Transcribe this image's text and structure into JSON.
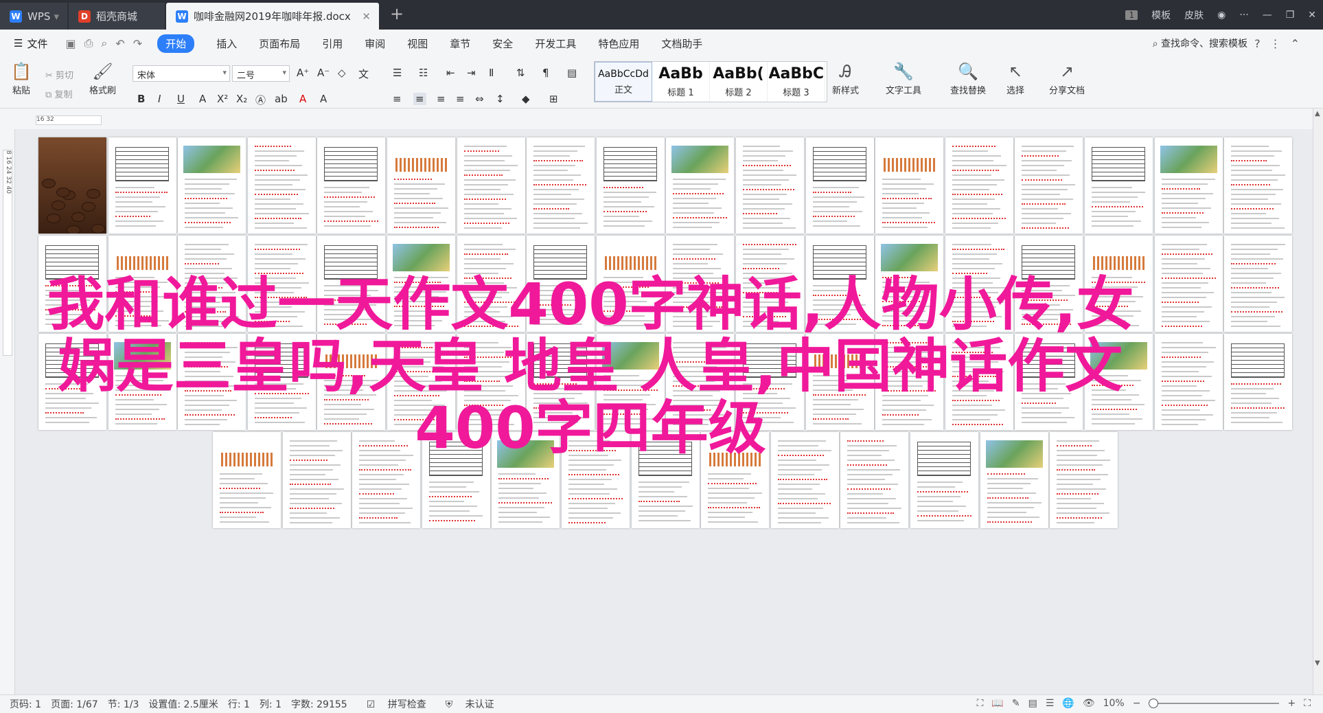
{
  "titlebar": {
    "tabs": [
      {
        "label": "WPS",
        "icon": "wps-logo-icon",
        "color": "#2d7ff9"
      },
      {
        "label": "稻壳商城",
        "icon": "docer-icon",
        "color": "#e0402b"
      },
      {
        "label": "咖啡金融网2019年咖啡年报.docx",
        "icon": "word-doc-icon",
        "color": "#2d7ff9"
      }
    ],
    "page_badge": "1",
    "right": [
      "模板",
      "皮肤"
    ]
  },
  "menubar": {
    "file": "文件",
    "items": [
      "开始",
      "插入",
      "页面布局",
      "引用",
      "审阅",
      "视图",
      "章节",
      "安全",
      "开发工具",
      "特色应用",
      "文档助手"
    ],
    "search": "查找命令、搜索模板"
  },
  "ribbon": {
    "paste": "粘贴",
    "cut": "剪切",
    "copy": "复制",
    "format_painter": "格式刷",
    "font_name": "宋体",
    "font_size": "二号",
    "styles": [
      {
        "sample": "AaBbCcDd",
        "label": "正文"
      },
      {
        "sample": "AaBb",
        "label": "标题 1"
      },
      {
        "sample": "AaBb(",
        "label": "标题 2"
      },
      {
        "sample": "AaBbC",
        "label": "标题 3"
      }
    ],
    "new_style": "新样式",
    "text_tools": "文字工具",
    "find_replace": "查找替换",
    "select": "选择",
    "share": "分享文档"
  },
  "ruler": {
    "h": "16   32",
    "v": "8  16  24  32  40"
  },
  "overlay": {
    "line1": "我和谁过一天作文400字神话,人物小传,女",
    "line2": "娲是三皇吗,天皇 地皇 人皇,中国神话作文",
    "line3": "400字四年级"
  },
  "status": {
    "page_num": "页码: 1",
    "page": "页面: 1/67",
    "section": "节: 1/3",
    "setting": "设置值: 2.5厘米",
    "row": "行: 1",
    "col": "列: 1",
    "words": "字数: 29155",
    "spell": "拼写检查",
    "auth": "未认证",
    "zoom": "10%"
  }
}
